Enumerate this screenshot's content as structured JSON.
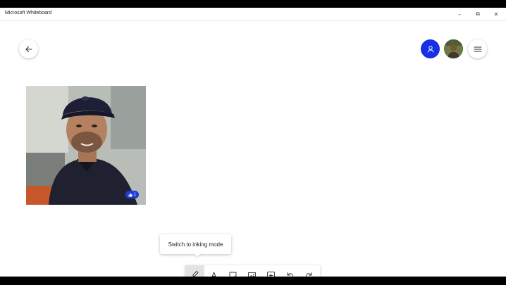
{
  "window": {
    "title": "Microsoft Whiteboard",
    "controls": {
      "minimize": "–",
      "restore": "⧉",
      "close": "✕"
    }
  },
  "canvas": {
    "photo": {
      "like_icon": "thumbs-up-icon",
      "like_count": "1"
    },
    "tooltip": {
      "text": "Switch to inking mode"
    }
  },
  "header": {
    "back_icon": "arrow-left-icon",
    "share_icon": "person-icon",
    "menu_icon": "hamburger-icon"
  },
  "toolbar": {
    "tools": [
      {
        "name": "inking-mode",
        "icon": "pen-hand-icon",
        "active": true
      },
      {
        "name": "text",
        "label": "A"
      },
      {
        "name": "sticky-note",
        "icon": "note-icon"
      },
      {
        "name": "image",
        "icon": "image-icon"
      },
      {
        "name": "insert",
        "icon": "plus-box-icon"
      },
      {
        "name": "undo",
        "icon": "undo-icon"
      },
      {
        "name": "redo",
        "icon": "redo-icon"
      }
    ]
  },
  "colors": {
    "accent": "#1730e6",
    "badge": "#1d3bd8"
  }
}
